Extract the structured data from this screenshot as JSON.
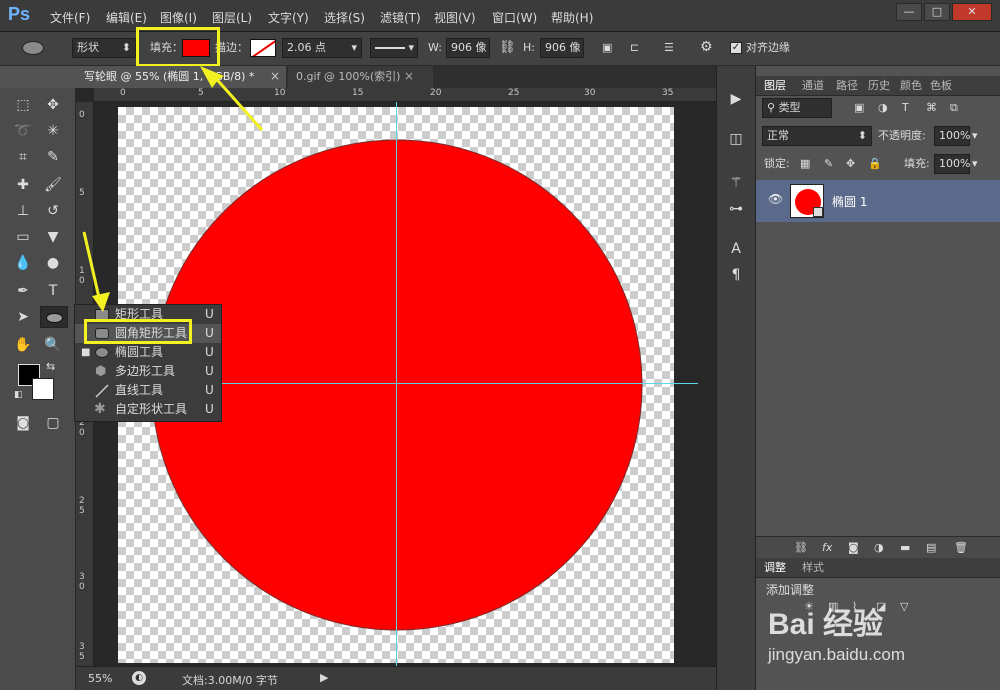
{
  "app": {
    "logo": "Ps"
  },
  "menu": [
    "文件(F)",
    "编辑(E)",
    "图像(I)",
    "图层(L)",
    "文字(Y)",
    "选择(S)",
    "滤镜(T)",
    "视图(V)",
    "窗口(W)",
    "帮助(H)"
  ],
  "window_buttons": {
    "minimize": "—",
    "maximize": "□",
    "close": "✕"
  },
  "options": {
    "mode": "形状",
    "fill_label": "填充：",
    "fill_color": "#ff0000",
    "stroke_label": "描边：",
    "stroke_width": "2.06 点",
    "w_label": "W:",
    "w_value": "906 像",
    "h_label": "H:",
    "h_value": "906 像",
    "align_edges": "对齐边缘"
  },
  "tabs": [
    {
      "label": "写轮眼 @ 55% (椭圆 1, RGB/8) *",
      "active": true
    },
    {
      "label": "0.gif @ 100%(索引)",
      "active": false
    }
  ],
  "tab_close": "×",
  "ruler_top": [
    "0",
    "5",
    "10",
    "15",
    "20",
    "25",
    "30",
    "35"
  ],
  "ruler_left": [
    "0",
    "5",
    "1 0",
    "1 5",
    "2 0",
    "2 5",
    "3 0",
    "3 5"
  ],
  "flyout": {
    "items": [
      {
        "label": "矩形工具",
        "key": "U"
      },
      {
        "label": "圆角矩形工具",
        "key": "U"
      },
      {
        "label": "椭圆工具",
        "key": "U"
      },
      {
        "label": "多边形工具",
        "key": "U"
      },
      {
        "label": "直线工具",
        "key": "U"
      },
      {
        "label": "自定形状工具",
        "key": "U"
      }
    ]
  },
  "status": {
    "zoom": "55%",
    "doc": "文档:3.00M/0 字节"
  },
  "layers_panel": {
    "tabs": [
      "图层",
      "通道",
      "路径",
      "历史",
      "颜色",
      "色板"
    ],
    "filter": "类型",
    "blend": "正常",
    "opacity_label": "不透明度:",
    "opacity": "100%",
    "lock_label": "锁定:",
    "fill_label": "填充:",
    "fill": "100%",
    "layer_name": "椭圆 1"
  },
  "adjust_panel": {
    "tabs": [
      "调整",
      "样式"
    ],
    "add_label": "添加调整"
  },
  "watermark": {
    "brand": "Bai 经验",
    "url": "jingyan.baidu.com"
  },
  "colors": {
    "shape": "#ff0000",
    "highlight": "#f3f120",
    "guide": "#5fd6e6"
  }
}
